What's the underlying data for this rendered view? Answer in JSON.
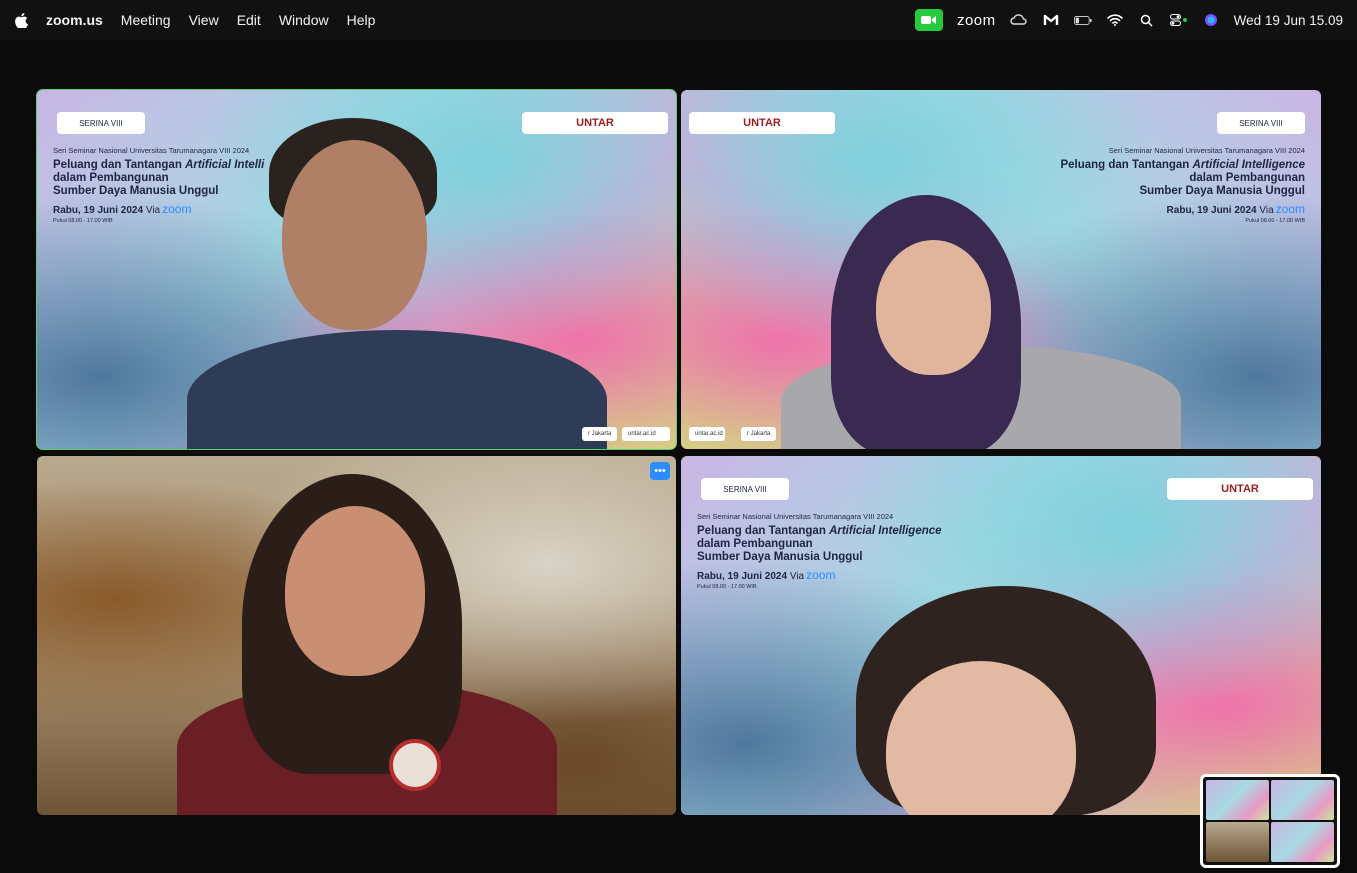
{
  "menubar": {
    "app_name": "zoom.us",
    "menus": [
      "Meeting",
      "View",
      "Edit",
      "Window",
      "Help"
    ],
    "zoom_status_label": "zoom",
    "datetime": "Wed 19 Jun  15.09",
    "icons": [
      "apple-icon",
      "zoom-camera-icon",
      "cloud-sync-icon",
      "malwarebytes-icon",
      "battery-icon",
      "wifi-icon",
      "search-icon",
      "control-center-icon",
      "siri-icon"
    ]
  },
  "event": {
    "series": "SERINA VIII",
    "series_sub": "UNTAR 2024",
    "subtitle": "Seri Seminar Nasional Universitas Tarumanagara VIII 2024",
    "title_line1_prefix": "Peluang dan Tantangan ",
    "title_line1_emph": "Artificial Intelligence",
    "title_line1_emph_cut": "Artificial Intelli",
    "title_line2": "dalam Pembangunan",
    "title_line3": "Sumber Daya Manusia Unggul",
    "date": "Rabu, 19 Juni 2024",
    "via": "Via",
    "zoom_logo": "zoom",
    "time": "Pukul 08.00 - 17.00 WIB",
    "org_badge": "UNTAR",
    "chip_left": "r Jakarta",
    "chip_right": "untar.ac.id"
  },
  "tiles": [
    {
      "id": "t1",
      "speaking": true
    },
    {
      "id": "t2",
      "mirrored": true
    },
    {
      "id": "t3",
      "blurred_background": true,
      "more_button": "•••"
    },
    {
      "id": "t4"
    }
  ],
  "colors": {
    "active_speaker_outline": "#5bd36a",
    "zoom_blue": "#2d8cff",
    "zoom_green": "#27c93f"
  }
}
